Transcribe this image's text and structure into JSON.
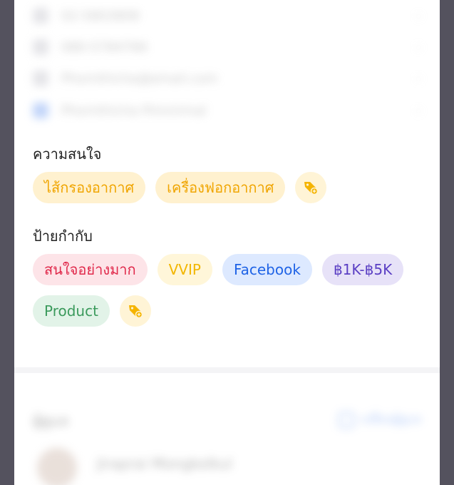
{
  "contacts": [
    {
      "text": "02-5803808",
      "icon": "phone-icon"
    },
    {
      "text": "080-5784766",
      "icon": "mobile-icon"
    },
    {
      "text": "Phornthicha@email.com",
      "icon": "mail-icon"
    },
    {
      "text": "Phornthicha Pimnirmal",
      "icon": "facebook-icon"
    }
  ],
  "interests": {
    "title": "ความสนใจ",
    "chips": [
      {
        "label": "ไส้กรองอากาศ",
        "bg": "#fff1cf",
        "fg": "#f0a500"
      },
      {
        "label": "เครื่องฟอกอากาศ",
        "bg": "#fff1cf",
        "fg": "#f0a500"
      }
    ],
    "add_icon": "tag-add-icon"
  },
  "tags": {
    "title": "ป้ายกำกับ",
    "chips": [
      {
        "label": "สนใจอย่างมาก",
        "bg": "#fde4e8",
        "fg": "#e0284a"
      },
      {
        "label": "VVIP",
        "bg": "#fff6d9",
        "fg": "#f2b600"
      },
      {
        "label": "Facebook",
        "bg": "#dde9ff",
        "fg": "#1f63e6"
      },
      {
        "label": "฿1K-฿5K",
        "bg": "#e7e2f8",
        "fg": "#5b3fc4"
      },
      {
        "label": "Product",
        "bg": "#e2f3e8",
        "fg": "#3b9a5c"
      }
    ],
    "add_icon": "tag-add-icon"
  },
  "owner": {
    "section_title": "ผู้ดูแล",
    "action_label": "เปลี่ยนผู้ดูแล",
    "name": "Jiraprai Mongkolkul"
  },
  "colors": {
    "accent_yellow": "#f5b400"
  }
}
